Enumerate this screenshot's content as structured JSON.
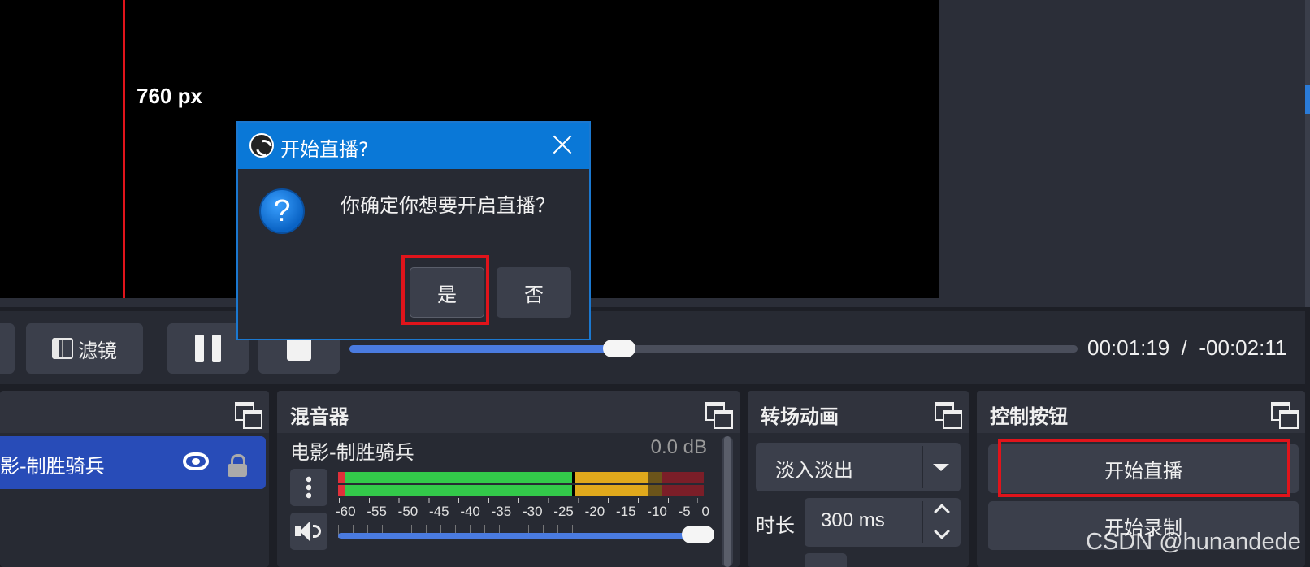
{
  "preview": {
    "guide_label": "760 px"
  },
  "toolbar": {
    "filter_label": "滤镜",
    "seek_progress": 0.37,
    "time_current": "00:01:19",
    "time_separator": "/",
    "time_remaining": "-00:02:11"
  },
  "sources": {
    "item_label": "影-制胜骑兵"
  },
  "mixer": {
    "title": "混音器",
    "channel_name": "电影-制胜骑兵",
    "channel_db": "0.0 dB",
    "scale_labels": [
      "-60",
      "-55",
      "-50",
      "-45",
      "-40",
      "-35",
      "-30",
      "-25",
      "-20",
      "-15",
      "-10",
      "-5",
      "0"
    ],
    "volume_level": 1.0
  },
  "transitions": {
    "title": "转场动画",
    "selected": "淡入淡出",
    "duration_label": "时长",
    "duration_value": "300 ms"
  },
  "controls": {
    "title": "控制按钮",
    "start_stream": "开始直播",
    "start_record": "开始录制"
  },
  "dialog": {
    "title": "开始直播?",
    "message": "你确定你想要开启直播？",
    "question_glyph": "?",
    "yes_label": "是",
    "no_label": "否"
  },
  "watermark": "CSDN @hunandede",
  "colors": {
    "accent_blue": "#0a78d7",
    "highlight_red": "#e0141b",
    "selected_source": "#284cb8"
  }
}
